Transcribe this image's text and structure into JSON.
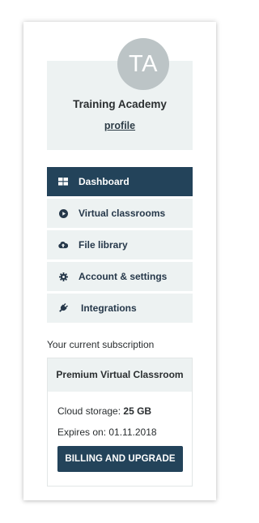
{
  "profile": {
    "avatar_initials": "TA",
    "org_name": "Training Academy",
    "profile_link": "profile"
  },
  "nav": {
    "items": [
      {
        "label": "Dashboard",
        "icon": "grid-icon",
        "active": true
      },
      {
        "label": "Virtual classrooms",
        "icon": "play-circle-icon",
        "active": false
      },
      {
        "label": "File library",
        "icon": "cloud-upload-icon",
        "active": false
      },
      {
        "label": "Account & settings",
        "icon": "gear-icon",
        "active": false
      },
      {
        "label": "Integrations",
        "icon": "plug-icon",
        "active": false
      }
    ]
  },
  "subscription": {
    "heading": "Your current subscription",
    "plan_name": "Premium Virtual Classroom",
    "storage_label": "Cloud storage:",
    "storage_value": "25 GB",
    "expires_label": "Expires on:",
    "expires_value": "01.11.2018",
    "button_label": "BILLING AND UPGRADE"
  },
  "colors": {
    "primary_dark": "#23435a",
    "panel_bg": "#edf2f2",
    "avatar_bg": "#bcc4c6",
    "text_dark": "#2a2e30"
  }
}
